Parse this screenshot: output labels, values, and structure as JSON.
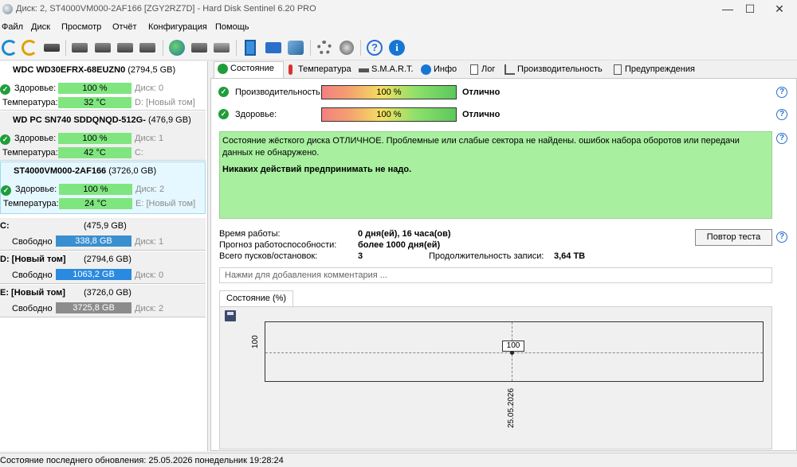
{
  "window": {
    "title": "Диск: 2, ST4000VM000-2AF166 [ZGY2RZ7D]  -  Hard Disk Sentinel 6.20 PRO",
    "minimize": "—",
    "maximize": "☐",
    "close": "✕"
  },
  "menu": [
    "Файл",
    "Диск",
    "Просмотр",
    "Отчёт",
    "Конфигурация",
    "Помощь"
  ],
  "toolbar": {
    "icons": [
      "refresh-icon",
      "refresh-warning-icon",
      "disk-icon",
      "drive-icon",
      "drive-schedule-icon",
      "drive-check-icon",
      "drive-search-icon",
      "globe-icon",
      "network-drive-icon",
      "recycle-icon",
      "notes-icon",
      "mail-icon",
      "network-icon",
      "gear-icon",
      "speaker-icon",
      "help-icon",
      "info-icon"
    ],
    "help_glyph": "?",
    "info_glyph": "i"
  },
  "disks": [
    {
      "name": "WDC WD30EFRX-68EUZN0",
      "size": "(2794,5 GB)",
      "health_label": "Здоровье:",
      "health": "100 %",
      "health_pct": 100,
      "disk_label": "Диск: 0",
      "temp_label": "Температура:",
      "temp": "32 °C",
      "volume": "D: [Новый том]",
      "selected": false
    },
    {
      "name": "WD PC SN740 SDDQNQD-512G-",
      "size": "(476,9 GB)",
      "health_label": "Здоровье:",
      "health": "100 %",
      "health_pct": 100,
      "disk_label": "Диск: 1",
      "temp_label": "Температура:",
      "temp": "42 °C",
      "volume": "C:",
      "selected": false
    },
    {
      "name": "ST4000VM000-2AF166",
      "size": "(3726,0 GB)",
      "health_label": "Здоровье:",
      "health": "100 %",
      "health_pct": 100,
      "disk_label": "Диск: 2",
      "temp_label": "Температура:",
      "temp": "24 °C",
      "volume": "E: [Новый том]",
      "selected": true
    }
  ],
  "volumes": [
    {
      "name": "C:",
      "size": "(475,9 GB)",
      "free_label": "Свободно",
      "free": "338,8 GB",
      "disk": "Диск: 1",
      "color": "#3a8fd0"
    },
    {
      "name": "D: [Новый том]",
      "size": "(2794,6 GB)",
      "free_label": "Свободно",
      "free": "1063,2 GB",
      "disk": "Диск: 0",
      "color": "#2a8ae0"
    },
    {
      "name": "E: [Новый том]",
      "size": "(3726,0 GB)",
      "free_label": "Свободно",
      "free": "3725,8 GB",
      "disk": "Диск: 2",
      "color": "#8c8c8c"
    }
  ],
  "tabs": [
    {
      "label": "Состояние",
      "icon": "check-icon",
      "active": true
    },
    {
      "label": "Температура",
      "icon": "thermometer-icon",
      "active": false
    },
    {
      "label": "S.M.A.R.T.",
      "icon": "smart-drive-icon",
      "active": false
    },
    {
      "label": "Инфо",
      "icon": "info-icon",
      "active": false
    },
    {
      "label": "Лог",
      "icon": "log-icon",
      "active": false
    },
    {
      "label": "Производительность",
      "icon": "performance-icon",
      "active": false
    },
    {
      "label": "Предупреждения",
      "icon": "alerts-icon",
      "active": false
    }
  ],
  "status": {
    "performance_label": "Производительность:",
    "performance_value": "100 %",
    "performance_rating": "Отлично",
    "health_label": "Здоровье:",
    "health_value": "100 %",
    "health_rating": "Отлично",
    "description": "Состояние жёсткого диска ОТЛИЧНОЕ. Проблемные или слабые сектора не найдены. ошибок набора оборотов или передачи данных не обнаружено.",
    "action": "Никаких действий предпринимать не надо.",
    "uptime_label": "Время работы:",
    "uptime": "0 дня(ей), 16 часа(ов)",
    "forecast_label": "Прогноз работоспособности:",
    "forecast": "более 1000 дня(ей)",
    "starts_label": "Всего пусков/остановок:",
    "starts": "3",
    "write_label": "Продолжительность записи:",
    "write": "3,64 TB",
    "retest_button": "Повтор теста",
    "comment_placeholder": "Нажми для добавления комментария ...",
    "chart_tab": "Состояние (%)"
  },
  "chart_data": {
    "type": "line",
    "x": [
      "25.05.2026"
    ],
    "series": [
      {
        "values": [
          100
        ]
      }
    ],
    "ytick": "100",
    "point_label": "100",
    "xlabel": "",
    "ylabel": ""
  },
  "statusbar": {
    "text": "Состояние последнего обновления: 25.05.2026 понедельник 19:28:24"
  }
}
